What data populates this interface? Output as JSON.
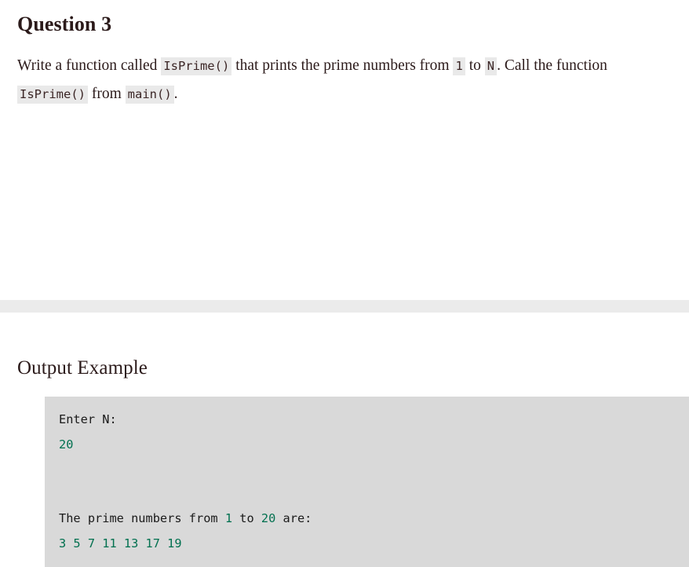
{
  "colors": {
    "page_background": "#ffffff",
    "text": "#2b1a1a",
    "inline_code_background": "#e9e9e9",
    "separator_band": "#ebebeb",
    "output_block_background": "#d9d9d9",
    "output_value_green": "#00704f",
    "output_text_black": "#1a1a1a"
  },
  "question": {
    "title": "Question 3",
    "body": {
      "part1": "Write a function called ",
      "code1": "IsPrime()",
      "part2": " that prints the prime numbers from ",
      "code2": "1",
      "part3": " to ",
      "code3": "N",
      "part4": ". Call the function ",
      "code4": "IsPrime()",
      "part5": " from ",
      "code5": "main()",
      "part6": "."
    }
  },
  "output_example": {
    "title": "Output Example",
    "lines": [
      {
        "segments": [
          {
            "text": "Enter N:",
            "style": "plain"
          }
        ]
      },
      {
        "segments": [
          {
            "text": "20",
            "style": "num"
          }
        ]
      },
      {
        "segments": [
          {
            "text": "",
            "style": "plain"
          }
        ]
      },
      {
        "segments": [
          {
            "text": "",
            "style": "plain"
          }
        ]
      },
      {
        "segments": [
          {
            "text": "The prime numbers from ",
            "style": "plain"
          },
          {
            "text": "1",
            "style": "num"
          },
          {
            "text": " to ",
            "style": "plain"
          },
          {
            "text": "20",
            "style": "num"
          },
          {
            "text": " are:",
            "style": "plain"
          }
        ]
      },
      {
        "segments": [
          {
            "text": "3 5 7 11 13 17 19",
            "style": "num"
          }
        ]
      }
    ],
    "raw_text": "Enter N:\n20\n\n\nThe prime numbers from 1 to 20 are:\n3 5 7 11 13 17 19",
    "entered_value": "20",
    "primes": [
      3,
      5,
      7,
      11,
      13,
      17,
      19
    ]
  }
}
